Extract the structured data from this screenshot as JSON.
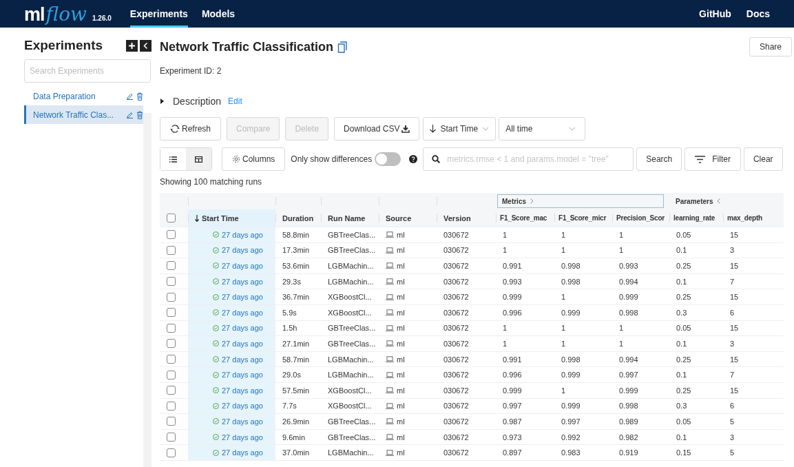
{
  "nav": {
    "logo_plain": "ml",
    "logo_script": "flow",
    "version": "1.26.0",
    "tabs": [
      {
        "label": "Experiments",
        "selected": true
      },
      {
        "label": "Models",
        "selected": false
      }
    ],
    "links": [
      "GitHub",
      "Docs"
    ]
  },
  "sidebar": {
    "title": "Experiments",
    "search": {
      "placeholder": "Search Experiments"
    },
    "items": [
      {
        "label": "Data Preparation",
        "selected": false
      },
      {
        "label": "Network Traffic Clas...",
        "selected": true
      }
    ]
  },
  "experiment": {
    "title": "Network Traffic Classification",
    "id_label": "Experiment ID:",
    "id": "2",
    "share": "Share",
    "description": {
      "label": "Description",
      "edit": "Edit",
      "expanded": false
    }
  },
  "toolbar": {
    "buttons": [
      {
        "label": "Refresh",
        "kind": "refresh",
        "disabled": false
      },
      {
        "label": "Compare",
        "kind": "plain",
        "disabled": true
      },
      {
        "label": "Delete",
        "kind": "plain",
        "disabled": true
      },
      {
        "label": "Download CSV",
        "kind": "download",
        "disabled": false
      }
    ],
    "sort": "Start Time",
    "time": "All time"
  },
  "views": [
    {
      "kind": "list",
      "selected": false
    },
    {
      "kind": "table",
      "selected": true
    }
  ],
  "columns_button": "Columns",
  "diff_toggle": {
    "label": "Only show differences",
    "on": false
  },
  "search": {
    "placeholder": "metrics.rmse < 1 and params.model = \"tree\"",
    "button": "Search"
  },
  "filter": "Filter",
  "clear": "Clear",
  "summary": "Showing 100 matching runs",
  "table": {
    "select_all": {
      "checked": false
    },
    "columns": [
      {
        "label": "Start Time",
        "kind": "time",
        "sorted": true
      },
      {
        "label": "Duration",
        "kind": "text",
        "sorted": false
      },
      {
        "label": "Run Name",
        "kind": "link",
        "sorted": false
      },
      {
        "label": "Source",
        "kind": "source",
        "sorted": false
      },
      {
        "label": "Version",
        "kind": "text",
        "sorted": false
      }
    ],
    "groups": [
      {
        "label": "Metrics",
        "expanded": false,
        "columns": [
          {
            "label": "F1_Score_mac",
            "sorted": false
          },
          {
            "label": "F1_Score_micr",
            "sorted": false
          },
          {
            "label": "Precision_Scor",
            "sorted": false
          }
        ]
      },
      {
        "label": "Parameters",
        "expanded": true,
        "columns": [
          {
            "label": "learning_rate",
            "sorted": false
          },
          {
            "label": "max_depth",
            "sorted": false
          }
        ]
      }
    ],
    "rows": [
      {
        "checked": false,
        "cells": [
          "27 days ago",
          "58.8min",
          "GBTreeClas...",
          "ml",
          "030672",
          "1",
          "1",
          "1",
          "0.05",
          "15"
        ]
      },
      {
        "checked": false,
        "cells": [
          "27 days ago",
          "17.3min",
          "GBTreeClas...",
          "ml",
          "030672",
          "1",
          "1",
          "1",
          "0.1",
          "3"
        ]
      },
      {
        "checked": false,
        "cells": [
          "27 days ago",
          "53.6min",
          "LGBMachin...",
          "ml",
          "030672",
          "0.991",
          "0.998",
          "0.993",
          "0.25",
          "15"
        ]
      },
      {
        "checked": false,
        "cells": [
          "27 days ago",
          "29.3s",
          "LGBMachin...",
          "ml",
          "030672",
          "0.993",
          "0.998",
          "0.994",
          "0.1",
          "7"
        ]
      },
      {
        "checked": false,
        "cells": [
          "27 days ago",
          "36.7min",
          "XGBoostCl...",
          "ml",
          "030672",
          "0.999",
          "1",
          "0.999",
          "0.25",
          "15"
        ]
      },
      {
        "checked": false,
        "cells": [
          "27 days ago",
          "5.9s",
          "XGBoostCl...",
          "ml",
          "030672",
          "0.996",
          "0.999",
          "0.998",
          "0.3",
          "6"
        ]
      },
      {
        "checked": false,
        "cells": [
          "27 days ago",
          "1.5h",
          "GBTreeClas...",
          "ml",
          "030672",
          "1",
          "1",
          "1",
          "0.05",
          "15"
        ]
      },
      {
        "checked": false,
        "cells": [
          "27 days ago",
          "27.1min",
          "GBTreeClas...",
          "ml",
          "030672",
          "1",
          "1",
          "1",
          "0.1",
          "3"
        ]
      },
      {
        "checked": false,
        "cells": [
          "27 days ago",
          "58.7min",
          "LGBMachin...",
          "ml",
          "030672",
          "0.991",
          "0.998",
          "0.994",
          "0.25",
          "15"
        ]
      },
      {
        "checked": false,
        "cells": [
          "27 days ago",
          "29.0s",
          "LGBMachin...",
          "ml",
          "030672",
          "0.996",
          "0.999",
          "0.997",
          "0.1",
          "7"
        ]
      },
      {
        "checked": false,
        "cells": [
          "27 days ago",
          "57.5min",
          "XGBoostCl...",
          "ml",
          "030672",
          "0.999",
          "1",
          "0.999",
          "0.25",
          "15"
        ]
      },
      {
        "checked": false,
        "cells": [
          "27 days ago",
          "7.7s",
          "XGBoostCl...",
          "ml",
          "030672",
          "0.997",
          "0.999",
          "0.998",
          "0.3",
          "6"
        ]
      },
      {
        "checked": false,
        "cells": [
          "27 days ago",
          "26.9min",
          "GBTreeClas...",
          "ml",
          "030672",
          "0.987",
          "0.997",
          "0.989",
          "0.05",
          "5"
        ]
      },
      {
        "checked": false,
        "cells": [
          "27 days ago",
          "9.6min",
          "GBTreeClas...",
          "ml",
          "030672",
          "0.973",
          "0.992",
          "0.982",
          "0.1",
          "3"
        ]
      },
      {
        "checked": false,
        "cells": [
          "27 days ago",
          "37.0min",
          "LGBMachin...",
          "ml",
          "030672",
          "0.897",
          "0.983",
          "0.919",
          "0.15",
          "5"
        ]
      }
    ]
  }
}
